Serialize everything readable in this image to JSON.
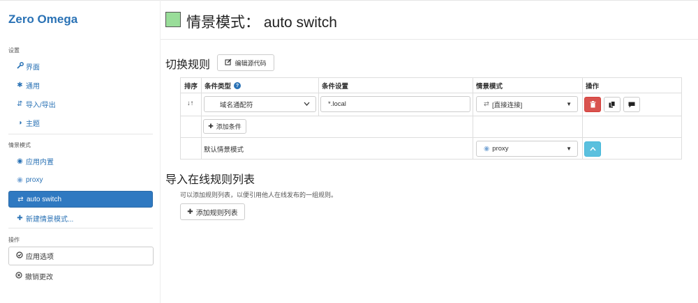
{
  "sidebar": {
    "brand": "Zero Omega",
    "settings_header": "设置",
    "settings_items": [
      {
        "icon": "wrench-icon",
        "glyph": "🔧",
        "label": "界面"
      },
      {
        "icon": "gear-icon",
        "glyph": "✱",
        "label": "通用"
      },
      {
        "icon": "import-export-icon",
        "glyph": "⇵",
        "label": "导入/导出"
      },
      {
        "icon": "theme-icon",
        "glyph": "◑",
        "label": "主题"
      }
    ],
    "profiles_header": "情景模式",
    "profile_items": [
      {
        "icon": "globe-icon",
        "glyph": "◉",
        "label": "应用内置"
      },
      {
        "icon": "globe-icon",
        "glyph": "◉",
        "label": "proxy"
      },
      {
        "icon": "switch-icon",
        "glyph": "⇄",
        "label": "auto switch"
      },
      {
        "icon": "plus-icon",
        "glyph": "✚",
        "label": "新建情景模式..."
      }
    ],
    "actions_header": "操作",
    "apply_label": "应用选项",
    "revert_label": "撤销更改"
  },
  "header": {
    "swatch_color": "#99dd99",
    "title": "情景模式： auto switch"
  },
  "rules_section": {
    "title": "切换规则",
    "edit_source_label": "编辑源代码",
    "columns": [
      "排序",
      "条件类型",
      "条件设置",
      "情景模式",
      "操作"
    ],
    "help_glyph": "?",
    "sort_glyph": "↓↑",
    "rule": {
      "condition_type": "域名通配符",
      "condition_value": "*.local",
      "profile": "[直接连接]"
    },
    "add_condition_label": "添加条件",
    "default_label": "默认情景模式",
    "default_profile": "proxy"
  },
  "online_section": {
    "title": "导入在线规则列表",
    "description": "可以添加规则列表，以便引用他人在线发布的一组规则。",
    "add_list_label": "添加规则列表"
  },
  "colors": {
    "accent": "#2a72b5",
    "active_bg": "#2f79c1",
    "danger": "#d9534f",
    "info": "#5bc0de"
  }
}
